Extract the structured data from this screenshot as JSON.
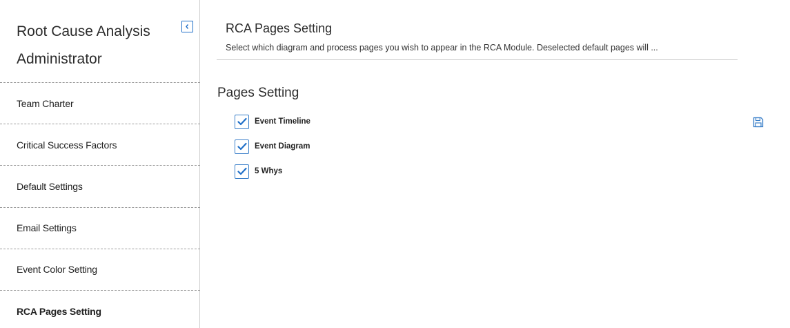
{
  "sidebar": {
    "title": "Root Cause Analysis Administrator",
    "collapse_icon": "chevron-left-icon",
    "items": [
      {
        "label": "Team Charter",
        "active": false
      },
      {
        "label": "Critical Success Factors",
        "active": false
      },
      {
        "label": "Default Settings",
        "active": false
      },
      {
        "label": "Email Settings",
        "active": false
      },
      {
        "label": "Event Color Setting",
        "active": false
      },
      {
        "label": "RCA Pages Setting",
        "active": true
      }
    ]
  },
  "main": {
    "title": "RCA Pages Setting",
    "description": "Select which diagram and process pages you wish to appear in the RCA Module. Deselected default pages will ...",
    "section_title": "Pages Setting",
    "save_icon": "save-icon",
    "pages": [
      {
        "label": "Event Timeline",
        "checked": true
      },
      {
        "label": "Event Diagram",
        "checked": true
      },
      {
        "label": "5 Whys",
        "checked": true
      }
    ]
  },
  "colors": {
    "accent": "#1f6fc8",
    "checkbox_border": "#3a7fc9",
    "divider": "#cfcfcf"
  }
}
